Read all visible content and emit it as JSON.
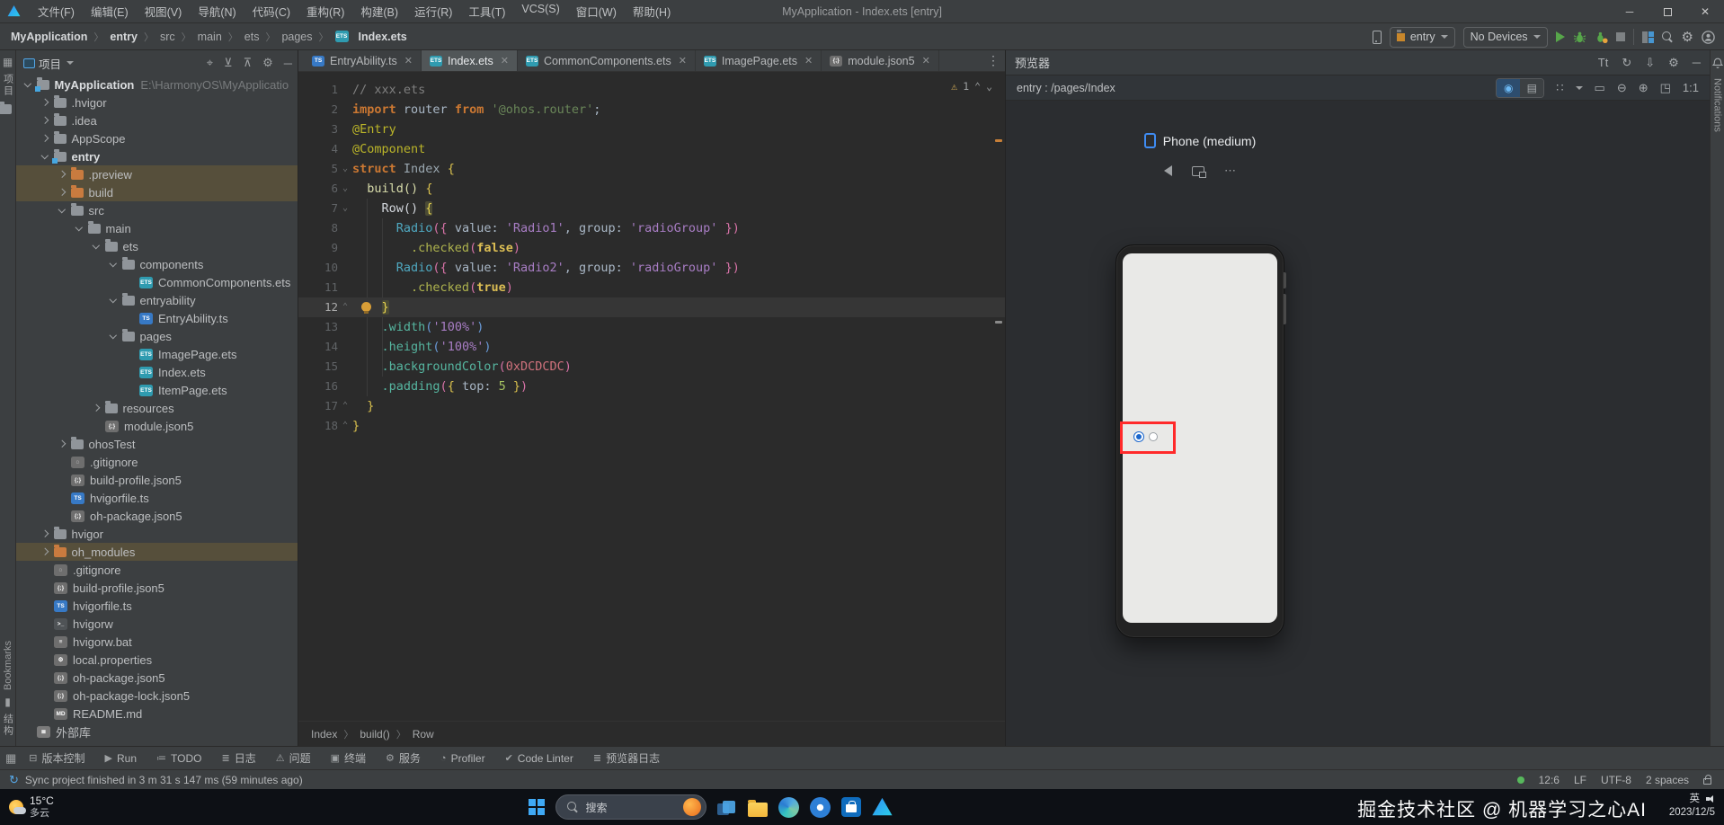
{
  "title_bar": {
    "title": "MyApplication - Index.ets [entry]",
    "menus": [
      "文件(F)",
      "编辑(E)",
      "视图(V)",
      "导航(N)",
      "代码(C)",
      "重构(R)",
      "构建(B)",
      "运行(R)",
      "工具(T)",
      "VCS(S)",
      "窗口(W)",
      "帮助(H)"
    ]
  },
  "toolbar": {
    "breadcrumb": [
      "MyApplication",
      "entry",
      "src",
      "main",
      "ets",
      "pages",
      "Index.ets"
    ],
    "module_selector": "entry",
    "device_selector": "No Devices"
  },
  "left_strip": {
    "top_label": "项目",
    "bookmarks_label": "Bookmarks",
    "bottom_label": "结构"
  },
  "right_strip": {
    "notifications_label": "Notifications"
  },
  "project_panel": {
    "title": "项目",
    "tree": [
      {
        "label": "MyApplication",
        "level": 0,
        "arrow": "e",
        "icon": "module",
        "bold": true,
        "suffix": "E:\\HarmonyOS\\MyApplicatio"
      },
      {
        "label": ".hvigor",
        "level": 1,
        "arrow": "c",
        "icon": "folder"
      },
      {
        "label": ".idea",
        "level": 1,
        "arrow": "c",
        "icon": "folder"
      },
      {
        "label": "AppScope",
        "level": 1,
        "arrow": "c",
        "icon": "folder"
      },
      {
        "label": "entry",
        "level": 1,
        "arrow": "e",
        "icon": "module",
        "bold": true
      },
      {
        "label": ".preview",
        "level": 2,
        "arrow": "c",
        "icon": "folder-orange",
        "hl": true
      },
      {
        "label": "build",
        "level": 2,
        "arrow": "c",
        "icon": "folder-orange",
        "hl": true
      },
      {
        "label": "src",
        "level": 2,
        "arrow": "e",
        "icon": "folder"
      },
      {
        "label": "main",
        "level": 3,
        "arrow": "e",
        "icon": "folder"
      },
      {
        "label": "ets",
        "level": 4,
        "arrow": "e",
        "icon": "folder"
      },
      {
        "label": "components",
        "level": 5,
        "arrow": "e",
        "icon": "folder"
      },
      {
        "label": "CommonComponents.ets",
        "level": 6,
        "arrow": "",
        "icon": "ets"
      },
      {
        "label": "entryability",
        "level": 5,
        "arrow": "e",
        "icon": "folder"
      },
      {
        "label": "EntryAbility.ts",
        "level": 6,
        "arrow": "",
        "icon": "ts"
      },
      {
        "label": "pages",
        "level": 5,
        "arrow": "e",
        "icon": "folder"
      },
      {
        "label": "ImagePage.ets",
        "level": 6,
        "arrow": "",
        "icon": "ets"
      },
      {
        "label": "Index.ets",
        "level": 6,
        "arrow": "",
        "icon": "ets"
      },
      {
        "label": "ItemPage.ets",
        "level": 6,
        "arrow": "",
        "icon": "ets"
      },
      {
        "label": "resources",
        "level": 4,
        "arrow": "c",
        "icon": "folder"
      },
      {
        "label": "module.json5",
        "level": 4,
        "arrow": "",
        "icon": "json"
      },
      {
        "label": "ohosTest",
        "level": 2,
        "arrow": "c",
        "icon": "folder"
      },
      {
        "label": ".gitignore",
        "level": 2,
        "arrow": "",
        "icon": "git"
      },
      {
        "label": "build-profile.json5",
        "level": 2,
        "arrow": "",
        "icon": "json"
      },
      {
        "label": "hvigorfile.ts",
        "level": 2,
        "arrow": "",
        "icon": "ts"
      },
      {
        "label": "oh-package.json5",
        "level": 2,
        "arrow": "",
        "icon": "json"
      },
      {
        "label": "hvigor",
        "level": 1,
        "arrow": "c",
        "icon": "folder"
      },
      {
        "label": "oh_modules",
        "level": 1,
        "arrow": "c",
        "icon": "folder-orange",
        "hl": true
      },
      {
        "label": ".gitignore",
        "level": 1,
        "arrow": "",
        "icon": "git"
      },
      {
        "label": "build-profile.json5",
        "level": 1,
        "arrow": "",
        "icon": "json"
      },
      {
        "label": "hvigorfile.ts",
        "level": 1,
        "arrow": "",
        "icon": "ts"
      },
      {
        "label": "hvigorw",
        "level": 1,
        "arrow": "",
        "icon": "console"
      },
      {
        "label": "hvigorw.bat",
        "level": 1,
        "arrow": "",
        "icon": "bat"
      },
      {
        "label": "local.properties",
        "level": 1,
        "arrow": "",
        "icon": "props"
      },
      {
        "label": "oh-package.json5",
        "level": 1,
        "arrow": "",
        "icon": "json"
      },
      {
        "label": "oh-package-lock.json5",
        "level": 1,
        "arrow": "",
        "icon": "json"
      },
      {
        "label": "README.md",
        "level": 1,
        "arrow": "",
        "icon": "md"
      },
      {
        "label": "外部库",
        "level": 0,
        "arrow": "",
        "icon": "lib"
      }
    ]
  },
  "editor": {
    "tabs": [
      {
        "label": "EntryAbility.ts",
        "icon": "ts",
        "active": false
      },
      {
        "label": "Index.ets",
        "icon": "ets",
        "active": true
      },
      {
        "label": "CommonComponents.ets",
        "icon": "ets",
        "active": false
      },
      {
        "label": "ImagePage.ets",
        "icon": "ets",
        "active": false
      },
      {
        "label": "module.json5",
        "icon": "json",
        "active": false
      }
    ],
    "inspection_count": "1",
    "code": [
      {
        "n": 1,
        "f": "",
        "t": [
          [
            "com",
            "// xxx.ets"
          ]
        ]
      },
      {
        "n": 2,
        "f": "",
        "t": [
          [
            "kw",
            "import"
          ],
          [
            "def",
            " router "
          ],
          [
            "kw",
            "from"
          ],
          [
            "def",
            " "
          ],
          [
            "str",
            "'@ohos.router'"
          ],
          [
            "def",
            ";"
          ]
        ]
      },
      {
        "n": 3,
        "f": "",
        "t": [
          [
            "dec",
            "@Entry"
          ]
        ]
      },
      {
        "n": 4,
        "f": "",
        "t": [
          [
            "dec",
            "@Component"
          ]
        ]
      },
      {
        "n": 5,
        "f": "d",
        "t": [
          [
            "kw",
            "struct"
          ],
          [
            "def",
            " "
          ],
          [
            "cls",
            "Index"
          ],
          [
            "def",
            " "
          ],
          [
            "b1",
            "{"
          ]
        ]
      },
      {
        "n": 6,
        "f": "d",
        "t": [
          [
            "def",
            "  "
          ],
          [
            "fn",
            "build()"
          ],
          [
            "def",
            " "
          ],
          [
            "b1",
            "{"
          ]
        ]
      },
      {
        "n": 7,
        "f": "d",
        "t": [
          [
            "def",
            "    "
          ],
          [
            "wht",
            "Row()"
          ],
          [
            "def",
            " "
          ],
          [
            "hlb",
            "{"
          ]
        ]
      },
      {
        "n": 8,
        "f": "",
        "t": [
          [
            "def",
            "      "
          ],
          [
            "comp",
            "Radio"
          ],
          [
            "b2",
            "({"
          ],
          [
            "def",
            " value: "
          ],
          [
            "strp",
            "'Radio1'"
          ],
          [
            "def",
            ", group: "
          ],
          [
            "strp",
            "'radioGroup'"
          ],
          [
            "def",
            " "
          ],
          [
            "b2",
            "})"
          ]
        ]
      },
      {
        "n": 9,
        "f": "",
        "t": [
          [
            "def",
            "        "
          ],
          [
            "olv",
            ".checked"
          ],
          [
            "b2",
            "("
          ],
          [
            "bool",
            "false"
          ],
          [
            "b2",
            ")"
          ]
        ]
      },
      {
        "n": 10,
        "f": "",
        "t": [
          [
            "def",
            "      "
          ],
          [
            "comp",
            "Radio"
          ],
          [
            "b2",
            "({"
          ],
          [
            "def",
            " value: "
          ],
          [
            "strp",
            "'Radio2'"
          ],
          [
            "def",
            ", group: "
          ],
          [
            "strp",
            "'radioGroup'"
          ],
          [
            "def",
            " "
          ],
          [
            "b2",
            "})"
          ]
        ]
      },
      {
        "n": 11,
        "f": "",
        "t": [
          [
            "def",
            "        "
          ],
          [
            "olv",
            ".checked"
          ],
          [
            "b2",
            "("
          ],
          [
            "bool",
            "true"
          ],
          [
            "b2",
            ")"
          ]
        ]
      },
      {
        "n": 12,
        "f": "u",
        "cur": true,
        "bulb": true,
        "t": [
          [
            "def",
            "    "
          ],
          [
            "hlb",
            "}"
          ]
        ]
      },
      {
        "n": 13,
        "f": "",
        "t": [
          [
            "def",
            "    "
          ],
          [
            "mth",
            ".width"
          ],
          [
            "b3",
            "("
          ],
          [
            "strp",
            "'100%'"
          ],
          [
            "b3",
            ")"
          ]
        ]
      },
      {
        "n": 14,
        "f": "",
        "t": [
          [
            "def",
            "    "
          ],
          [
            "mth",
            ".height"
          ],
          [
            "b3",
            "("
          ],
          [
            "strp",
            "'100%'"
          ],
          [
            "b3",
            ")"
          ]
        ]
      },
      {
        "n": 15,
        "f": "",
        "t": [
          [
            "def",
            "    "
          ],
          [
            "mth",
            ".backgroundColor"
          ],
          [
            "b2",
            "("
          ],
          [
            "hex",
            "0xDCDCDC"
          ],
          [
            "b2",
            ")"
          ]
        ]
      },
      {
        "n": 16,
        "f": "",
        "t": [
          [
            "def",
            "    "
          ],
          [
            "mth",
            ".padding"
          ],
          [
            "b2",
            "("
          ],
          [
            "b1",
            "{"
          ],
          [
            "def",
            " top: "
          ],
          [
            "num",
            "5"
          ],
          [
            "def",
            " "
          ],
          [
            "b1",
            "}"
          ],
          [
            "b2",
            ")"
          ]
        ]
      },
      {
        "n": 17,
        "f": "u",
        "t": [
          [
            "def",
            "  "
          ],
          [
            "b1",
            "}"
          ]
        ]
      },
      {
        "n": 18,
        "f": "u",
        "t": [
          [
            "b1",
            "}"
          ]
        ]
      }
    ],
    "breadcrumb": [
      "Index",
      "build()",
      "Row"
    ]
  },
  "previewer": {
    "title": "预览器",
    "route": "entry : /pages/Index",
    "device_label": "Phone (medium)",
    "zoom_label": "1:1"
  },
  "bottom_bar": {
    "items": [
      {
        "icon": "⊟",
        "label": "版本控制"
      },
      {
        "icon": "▶",
        "label": "Run"
      },
      {
        "icon": "≔",
        "label": "TODO"
      },
      {
        "icon": "≣",
        "label": "日志"
      },
      {
        "icon": "⚠",
        "label": "问题"
      },
      {
        "icon": "▣",
        "label": "终端"
      },
      {
        "icon": "⚙",
        "label": "服务"
      },
      {
        "icon": "◔",
        "label": "Profiler"
      },
      {
        "icon": "✔",
        "label": "Code Linter"
      },
      {
        "icon": "≣",
        "label": "预览器日志"
      }
    ]
  },
  "status_bar": {
    "message": "Sync project finished in 3 m 31 s 147 ms (59 minutes ago)",
    "caret": "12:6",
    "line_ending": "LF",
    "encoding": "UTF-8",
    "indent": "2 spaces"
  },
  "taskbar": {
    "temperature": "15°C",
    "condition": "多云",
    "search_placeholder": "搜索",
    "watermark": "掘金技术社区 @ 机器学习之心AI",
    "ime": "英",
    "date": "2023/12/5"
  },
  "colors": {
    "accent_blue": "#46A7E0",
    "radio_blue": "#1A66CC",
    "highlight_red": "#FF2A2A",
    "run_green": "#57A64A",
    "file_ets": "#2F9BB0",
    "file_ts": "#3779C5"
  }
}
